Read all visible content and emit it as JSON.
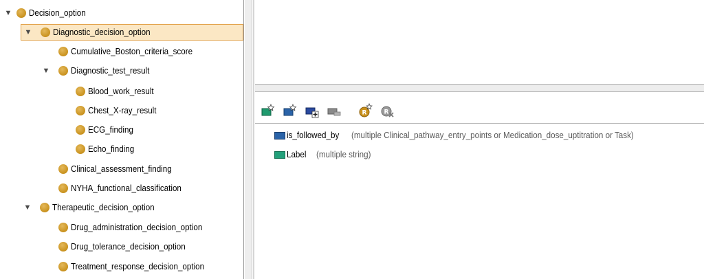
{
  "tree": {
    "items": [
      {
        "label": "Decision_option",
        "toggle": "▼"
      },
      {
        "label": "Diagnostic_decision_option",
        "toggle": "▼"
      },
      {
        "label": "Cumulative_Boston_criteria_score",
        "toggle": ""
      },
      {
        "label": "Diagnostic_test_result",
        "toggle": "▼"
      },
      {
        "label": "Blood_work_result",
        "toggle": ""
      },
      {
        "label": "Chest_X-ray_result",
        "toggle": ""
      },
      {
        "label": "ECG_finding",
        "toggle": ""
      },
      {
        "label": "Echo_finding",
        "toggle": ""
      },
      {
        "label": "Clinical_assessment_finding",
        "toggle": ""
      },
      {
        "label": "NYHA_functional_classification",
        "toggle": ""
      },
      {
        "label": "Therapeutic_decision_option",
        "toggle": "▼"
      },
      {
        "label": "Drug_administration_decision_option",
        "toggle": ""
      },
      {
        "label": "Drug_tolerance_decision_option",
        "toggle": ""
      },
      {
        "label": "Treatment_response_decision_option",
        "toggle": ""
      }
    ],
    "selected_item": "Diagnostic_decision_option"
  },
  "toolbar": {
    "buttons": [
      {
        "name": "add-data-property-icon",
        "color": "#1f9a6e"
      },
      {
        "name": "add-object-property-icon",
        "color": "#2a63a8"
      },
      {
        "name": "add-property-to-class-icon",
        "color": "#2a4aa0"
      },
      {
        "name": "remove-property-icon",
        "color": "#8a8a8a"
      },
      {
        "name": "create-restriction-icon",
        "color": "#c9921e"
      },
      {
        "name": "delete-restriction-icon",
        "color": "#9a9a9a"
      }
    ]
  },
  "properties": [
    {
      "name": "is_followed_by",
      "description": "(multiple Clinical_pathway_entry_points or Medication_dose_uptitration or Task)",
      "icon_color": "#2a63a8"
    },
    {
      "name": "Label",
      "description": "(multiple string)",
      "icon_color": "#22a07a"
    }
  ]
}
